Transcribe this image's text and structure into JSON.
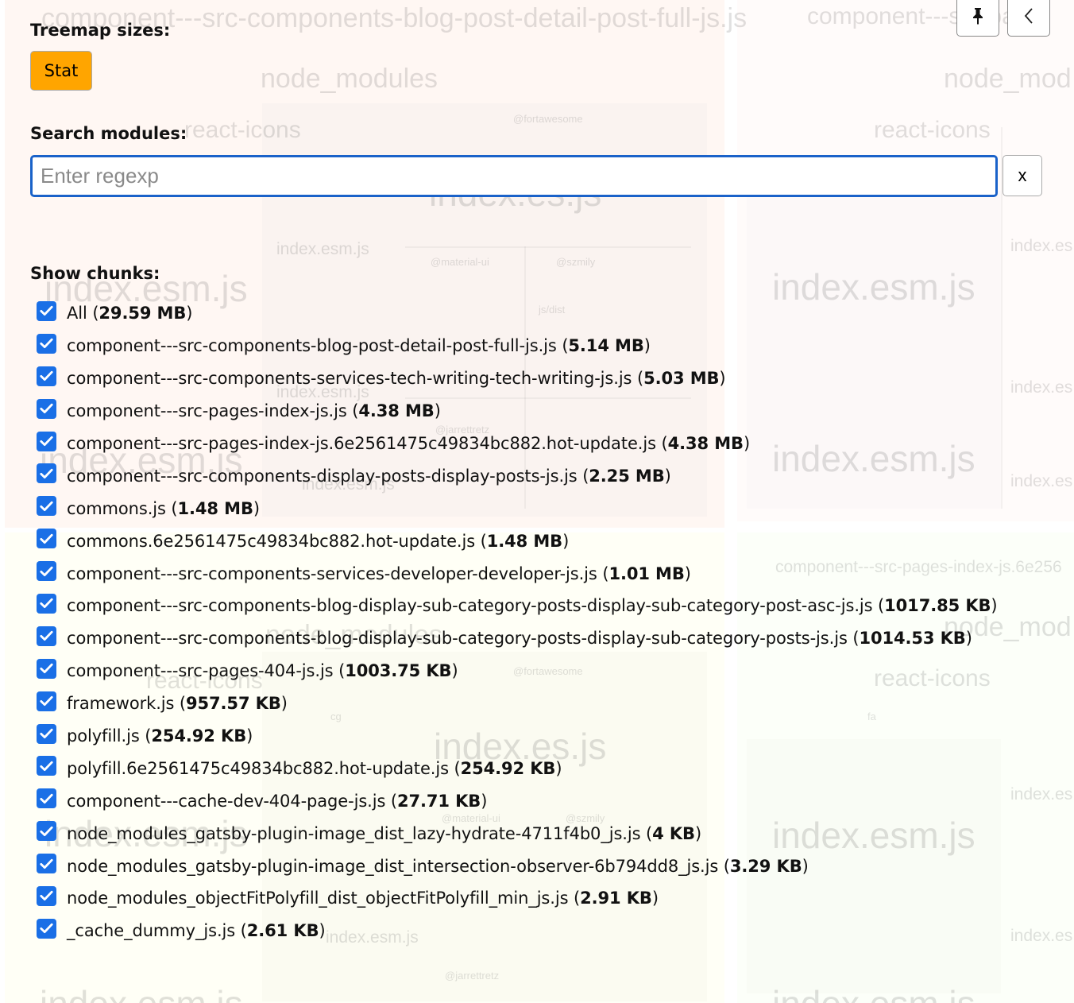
{
  "treemap_labels": {
    "top_chunk": "component---src-components-blog-post-detail-post-full-js.js",
    "top_right_chunk": "component---src-pa",
    "node_modules": "node_modules",
    "node_modules_right": "node_mod",
    "react_icons": "react-icons",
    "index_es": "index.es.js",
    "index_esm": "index.esm.js",
    "index_esm_right": "index.es",
    "fortawesome": "@fortawesome",
    "material_ui": "@material-ui",
    "szmily": "@szmily",
    "jarrettretz": "@jarrettretz",
    "fa": "fa",
    "cg": "cg",
    "js_dist": "js/dist",
    "mid_chunk_right": "component---src-pages-index-js.6e256"
  },
  "treemap_sizes": {
    "title": "Treemap sizes:",
    "stat_label": "Stat"
  },
  "search": {
    "title": "Search modules:",
    "placeholder": "Enter regexp",
    "value": "",
    "clear_label": "x"
  },
  "chunks": {
    "title": "Show chunks:",
    "items": [
      {
        "label": "All",
        "size": "29.59 MB",
        "checked": true
      },
      {
        "label": "component---src-components-blog-post-detail-post-full-js.js",
        "size": "5.14 MB",
        "checked": true
      },
      {
        "label": "component---src-components-services-tech-writing-tech-writing-js.js",
        "size": "5.03 MB",
        "checked": true
      },
      {
        "label": "component---src-pages-index-js.js",
        "size": "4.38 MB",
        "checked": true
      },
      {
        "label": "component---src-pages-index-js.6e2561475c49834bc882.hot-update.js",
        "size": "4.38 MB",
        "checked": true
      },
      {
        "label": "component---src-components-display-posts-display-posts-js.js",
        "size": "2.25 MB",
        "checked": true
      },
      {
        "label": "commons.js",
        "size": "1.48 MB",
        "checked": true
      },
      {
        "label": "commons.6e2561475c49834bc882.hot-update.js",
        "size": "1.48 MB",
        "checked": true
      },
      {
        "label": "component---src-components-services-developer-developer-js.js",
        "size": "1.01 MB",
        "checked": true
      },
      {
        "label": "component---src-components-blog-display-sub-category-posts-display-sub-category-post-asc-js.js",
        "size": "1017.85 KB",
        "checked": true
      },
      {
        "label": "component---src-components-blog-display-sub-category-posts-display-sub-category-posts-js.js",
        "size": "1014.53 KB",
        "checked": true
      },
      {
        "label": "component---src-pages-404-js.js",
        "size": "1003.75 KB",
        "checked": true
      },
      {
        "label": "framework.js",
        "size": "957.57 KB",
        "checked": true
      },
      {
        "label": "polyfill.js",
        "size": "254.92 KB",
        "checked": true
      },
      {
        "label": "polyfill.6e2561475c49834bc882.hot-update.js",
        "size": "254.92 KB",
        "checked": true
      },
      {
        "label": "component---cache-dev-404-page-js.js",
        "size": "27.71 KB",
        "checked": true
      },
      {
        "label": "node_modules_gatsby-plugin-image_dist_lazy-hydrate-4711f4b0_js.js",
        "size": "4 KB",
        "checked": true
      },
      {
        "label": "node_modules_gatsby-plugin-image_dist_intersection-observer-6b794dd8_js.js",
        "size": "3.29 KB",
        "checked": true
      },
      {
        "label": "node_modules_objectFitPolyfill_dist_objectFitPolyfill_min_js.js",
        "size": "2.91 KB",
        "checked": true
      },
      {
        "label": "_cache_dummy_js.js",
        "size": "2.61 KB",
        "checked": true
      }
    ]
  },
  "toolbar": {
    "pin_icon": "pin-icon",
    "collapse_icon": "chevron-left-icon"
  },
  "colors": {
    "accent": "#1a62c9",
    "stat_active": "#ffa500",
    "checkbox": "#1a6fe6"
  }
}
